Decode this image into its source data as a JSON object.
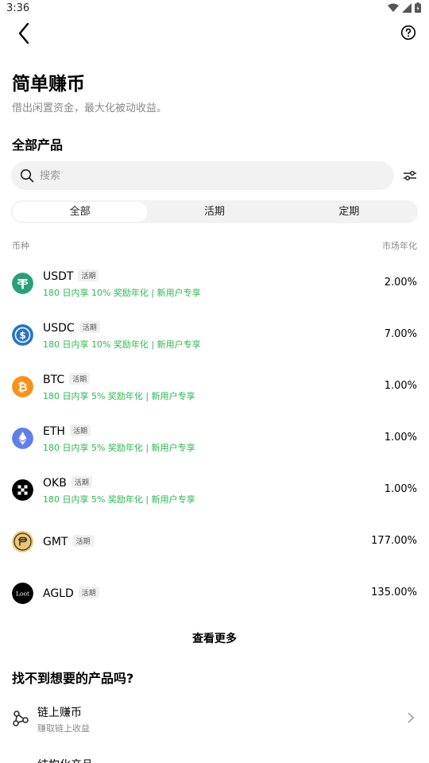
{
  "status": {
    "time": "3:36"
  },
  "header": {
    "title": "简单赚币",
    "subtitle": "借出闲置资金，最大化被动收益。"
  },
  "section_title": "全部产品",
  "search": {
    "placeholder": "搜索"
  },
  "tabs": [
    {
      "label": "全部",
      "active": true
    },
    {
      "label": "活期",
      "active": false
    },
    {
      "label": "定期",
      "active": false
    }
  ],
  "columns": {
    "coin": "币种",
    "rate": "市场年化"
  },
  "products": [
    {
      "name": "USDT",
      "badge": "活期",
      "promo": "180 日内享 10% 奖励年化 | 新用户专享",
      "rate": "2.00%",
      "icon": "usdt-icon",
      "color": "#26a17b"
    },
    {
      "name": "USDC",
      "badge": "活期",
      "promo": "180 日内享 10% 奖励年化 | 新用户专享",
      "rate": "7.00%",
      "icon": "usdc-icon",
      "color": "#2775ca"
    },
    {
      "name": "BTC",
      "badge": "活期",
      "promo": "180 日内享 5% 奖励年化 | 新用户专享",
      "rate": "1.00%",
      "icon": "btc-icon",
      "color": "#f7931a"
    },
    {
      "name": "ETH",
      "badge": "活期",
      "promo": "180 日内享 5% 奖励年化 | 新用户专享",
      "rate": "1.00%",
      "icon": "eth-icon",
      "color": "#627eea"
    },
    {
      "name": "OKB",
      "badge": "活期",
      "promo": "180 日内享 5% 奖励年化 | 新用户专享",
      "rate": "1.00%",
      "icon": "okb-icon",
      "color": "#000000"
    },
    {
      "name": "GMT",
      "badge": "活期",
      "promo": "",
      "rate": "177.00%",
      "icon": "gmt-icon",
      "color": "#e9c77a"
    },
    {
      "name": "AGLD",
      "badge": "活期",
      "promo": "",
      "rate": "135.00%",
      "icon": "loot-icon",
      "color": "#000000",
      "icon_text": "Loot"
    }
  ],
  "see_more": "查看更多",
  "cant_find": "找不到想要的产品吗?",
  "links": [
    {
      "title": "链上赚币",
      "subtitle": "赚取链上收益"
    },
    {
      "title": "结构化产品"
    }
  ],
  "accent": "#2db84d"
}
